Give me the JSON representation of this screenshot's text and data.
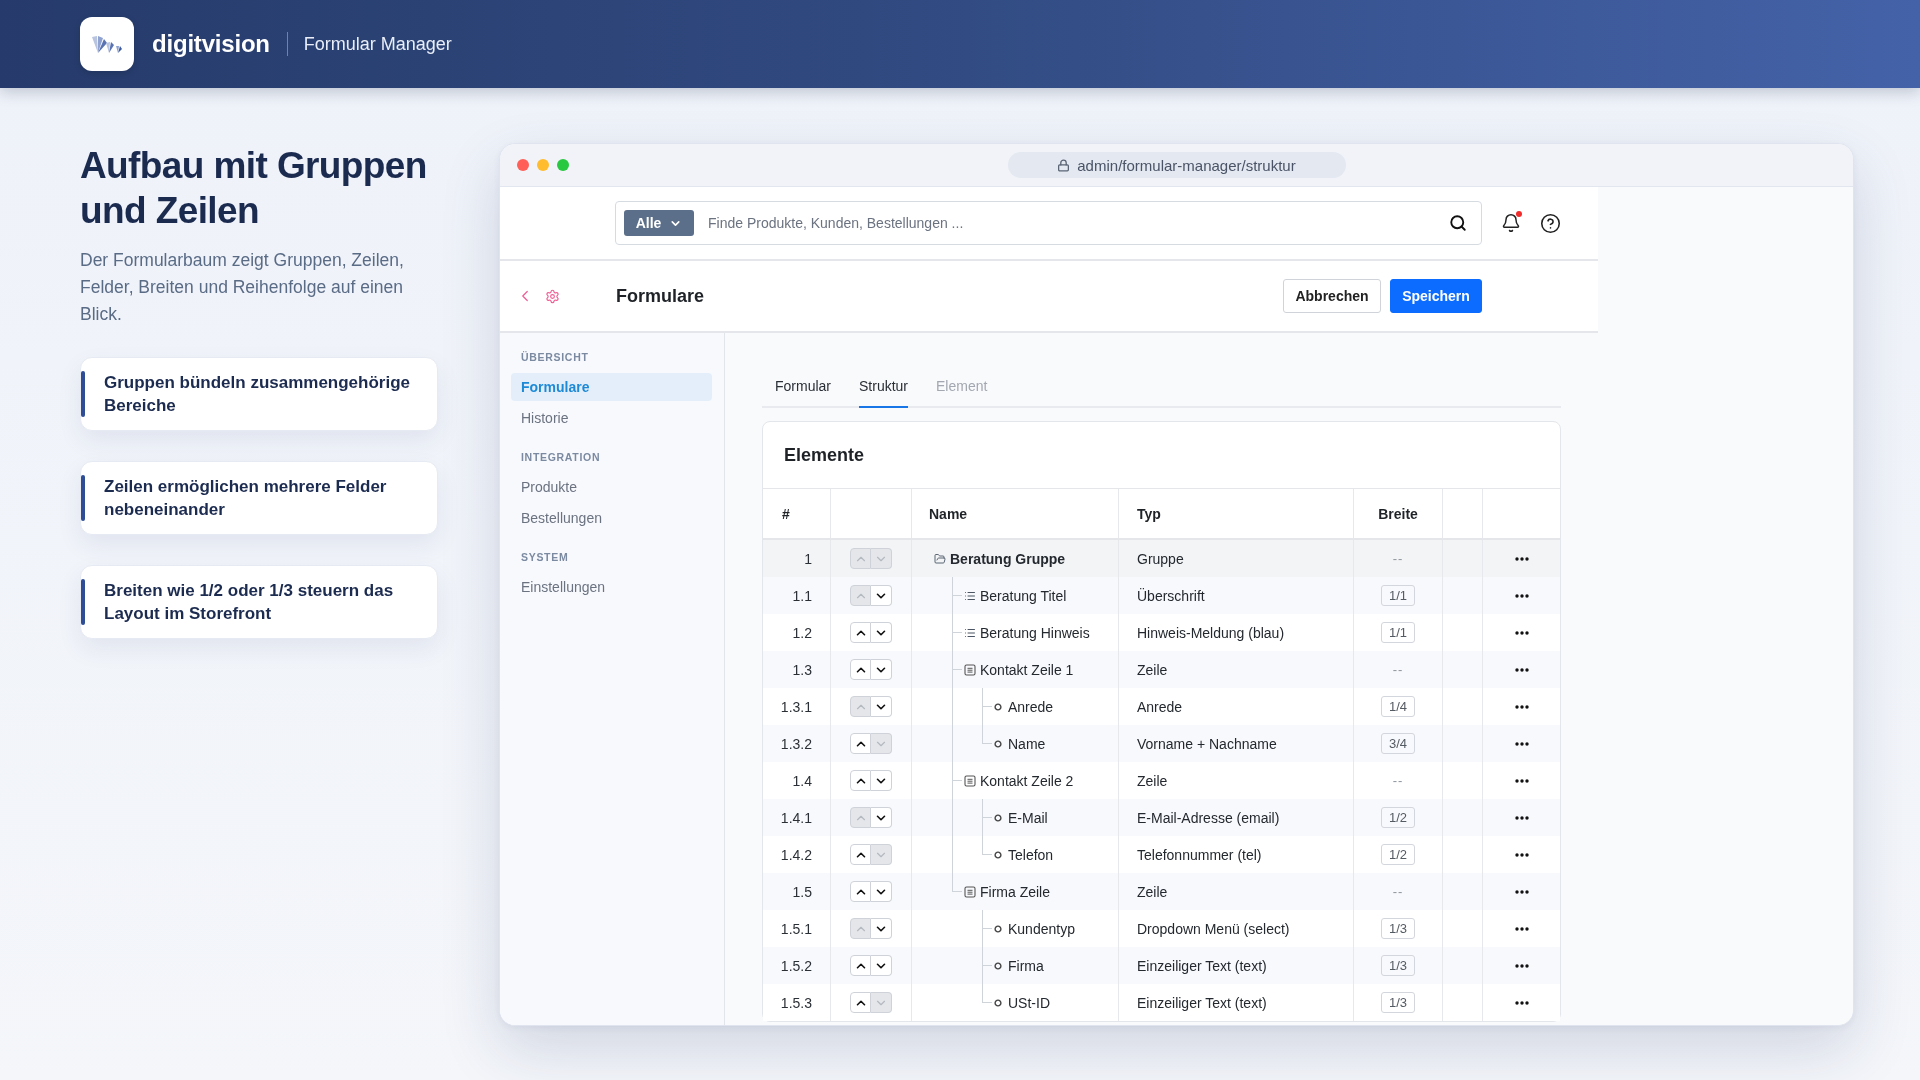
{
  "header": {
    "brand": "digitvision",
    "product": "Formular Manager"
  },
  "intro": {
    "title": "Aufbau mit Gruppen und Zeilen",
    "text": "Der Formularbaum zeigt Gruppen, Zeilen, Felder, Breiten und Reihenfolge auf einen Blick.",
    "points": [
      "Gruppen bündeln zusammengehörige Bereiche",
      "Zeilen ermöglichen mehrere Felder nebeneinander",
      "Breiten wie 1/2 oder 1/3 steuern das Layout im Storefront"
    ]
  },
  "browser": {
    "url": "admin/formular-manager/struktur"
  },
  "topbar": {
    "scope": "Alle",
    "search_placeholder": "Finde Produkte, Kunden, Bestellungen ...",
    "notifications_unread": true
  },
  "toolbar": {
    "title": "Formulare",
    "buttons": [
      {
        "label": "Abbrechen",
        "kind": "secondary"
      },
      {
        "label": "Speichern",
        "kind": "primary"
      }
    ]
  },
  "sidebar": {
    "sections": [
      {
        "label": "ÜBERSICHT",
        "items": [
          {
            "label": "Formulare",
            "selected": true
          },
          {
            "label": "Historie",
            "selected": false
          }
        ]
      },
      {
        "label": "INTEGRATION",
        "items": [
          {
            "label": "Produkte",
            "selected": false
          },
          {
            "label": "Bestellungen",
            "selected": false
          }
        ]
      },
      {
        "label": "SYSTEM",
        "items": [
          {
            "label": "Einstellungen",
            "selected": false
          }
        ]
      }
    ]
  },
  "tabs": [
    {
      "label": "Formular",
      "selected": false,
      "disabled": false
    },
    {
      "label": "Struktur",
      "selected": true,
      "disabled": false
    },
    {
      "label": "Element",
      "selected": false,
      "disabled": true
    }
  ],
  "table": {
    "title": "Elemente",
    "columns": {
      "number": "#",
      "name": "Name",
      "type": "Typ",
      "width": "Breite"
    },
    "rows": [
      {
        "number": "1",
        "name": "Beratung Gruppe",
        "type": "Gruppe",
        "width": "--",
        "width_set": false,
        "kind": "group",
        "up_disabled": true,
        "down_disabled": true,
        "children": [
          {
            "number": "1.1",
            "name": "Beratung Titel",
            "type": "Überschrift",
            "width": "1/1",
            "width_set": true,
            "kind": "element",
            "up_disabled": true,
            "down_disabled": false
          },
          {
            "number": "1.2",
            "name": "Beratung Hinweis",
            "type": "Hinweis-Meldung (blau)",
            "width": "1/1",
            "width_set": true,
            "kind": "element",
            "up_disabled": false,
            "down_disabled": false
          },
          {
            "number": "1.3",
            "name": "Kontakt Zeile 1",
            "type": "Zeile",
            "width": "--",
            "width_set": false,
            "kind": "row",
            "up_disabled": false,
            "down_disabled": false,
            "children": [
              {
                "number": "1.3.1",
                "name": "Anrede",
                "type": "Anrede",
                "width": "1/4",
                "width_set": true,
                "kind": "field",
                "up_disabled": true,
                "down_disabled": false
              },
              {
                "number": "1.3.2",
                "name": "Name",
                "type": "Vorname + Nachname",
                "width": "3/4",
                "width_set": true,
                "kind": "field",
                "up_disabled": false,
                "down_disabled": true
              }
            ]
          },
          {
            "number": "1.4",
            "name": "Kontakt Zeile 2",
            "type": "Zeile",
            "width": "--",
            "width_set": false,
            "kind": "row",
            "up_disabled": false,
            "down_disabled": false,
            "children": [
              {
                "number": "1.4.1",
                "name": "E-Mail",
                "type": "E-Mail-Adresse (email)",
                "width": "1/2",
                "width_set": true,
                "kind": "field",
                "up_disabled": true,
                "down_disabled": false
              },
              {
                "number": "1.4.2",
                "name": "Telefon",
                "type": "Telefonnummer (tel)",
                "width": "1/2",
                "width_set": true,
                "kind": "field",
                "up_disabled": false,
                "down_disabled": true
              }
            ]
          },
          {
            "number": "1.5",
            "name": "Firma Zeile",
            "type": "Zeile",
            "width": "--",
            "width_set": false,
            "kind": "row",
            "up_disabled": false,
            "down_disabled": false,
            "children": [
              {
                "number": "1.5.1",
                "name": "Kundentyp",
                "type": "Dropdown Menü (select)",
                "width": "1/3",
                "width_set": true,
                "kind": "field",
                "up_disabled": true,
                "down_disabled": false
              },
              {
                "number": "1.5.2",
                "name": "Firma",
                "type": "Einzeiliger Text (text)",
                "width": "1/3",
                "width_set": true,
                "kind": "field",
                "up_disabled": false,
                "down_disabled": false
              },
              {
                "number": "1.5.3",
                "name": "USt-ID",
                "type": "Einzeiliger Text (text)",
                "width": "1/3",
                "width_set": true,
                "kind": "field",
                "up_disabled": false,
                "down_disabled": true
              }
            ]
          }
        ]
      }
    ]
  }
}
